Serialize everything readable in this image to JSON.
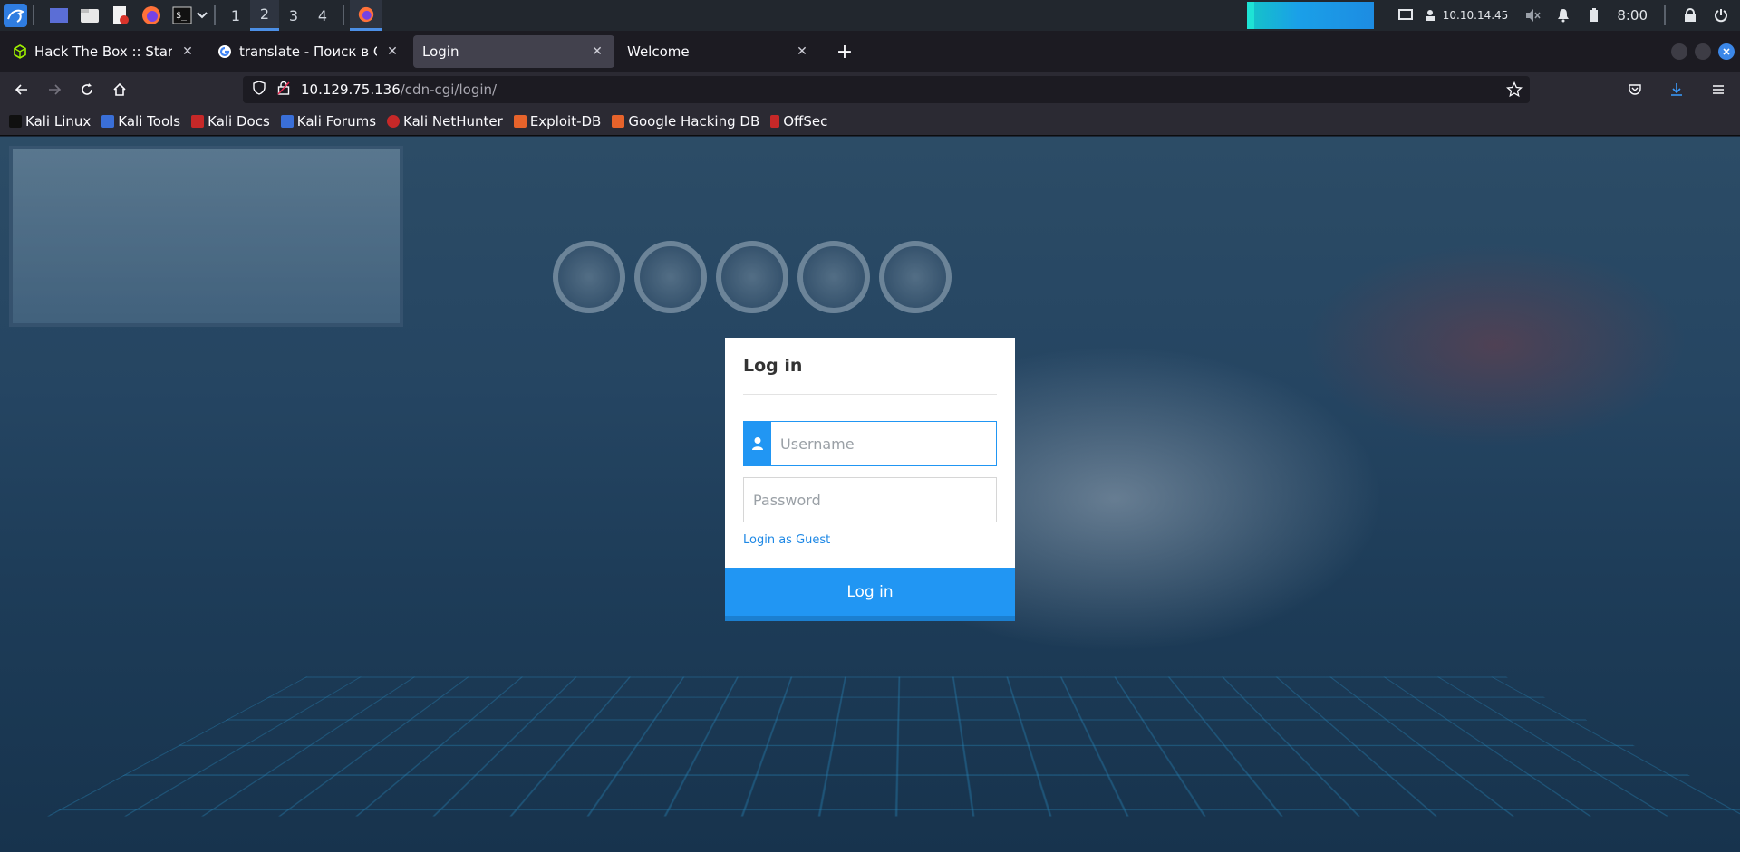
{
  "taskbar": {
    "workspaces": [
      "1",
      "2",
      "3",
      "4"
    ],
    "active_workspace": "2",
    "ip_address": "10.10.14.45",
    "clock": "8:00"
  },
  "tabs": [
    {
      "label": "Hack The Box :: Starting P",
      "favicon": "htb-cube-icon",
      "active": false
    },
    {
      "label": "translate - Поиск в Googl",
      "favicon": "google-icon",
      "active": false
    },
    {
      "label": "Login",
      "favicon": "",
      "active": true
    },
    {
      "label": "Welcome",
      "favicon": "",
      "active": false
    }
  ],
  "url": {
    "host": "10.129.75.136",
    "path": "/cdn-cgi/login/"
  },
  "bookmarks": [
    {
      "label": "Kali Linux",
      "icon": "kali-dragon-icon",
      "color": "#1f1f1f"
    },
    {
      "label": "Kali Tools",
      "icon": "kali-tools-icon",
      "color": "#3a6fd8"
    },
    {
      "label": "Kali Docs",
      "icon": "kali-docs-icon",
      "color": "#c62828"
    },
    {
      "label": "Kali Forums",
      "icon": "kali-forums-icon",
      "color": "#3a6fd8"
    },
    {
      "label": "Kali NetHunter",
      "icon": "nethunter-icon",
      "color": "#c62828"
    },
    {
      "label": "Exploit-DB",
      "icon": "exploit-db-icon",
      "color": "#e6632b"
    },
    {
      "label": "Google Hacking DB",
      "icon": "ghdb-icon",
      "color": "#e6632b"
    },
    {
      "label": "OffSec",
      "icon": "offsec-icon",
      "color": "#c62828"
    }
  ],
  "login": {
    "title": "Log in",
    "username_placeholder": "Username",
    "password_placeholder": "Password",
    "guest_link": "Login as Guest",
    "submit_label": "Log in",
    "accent_color": "#2196f3"
  }
}
